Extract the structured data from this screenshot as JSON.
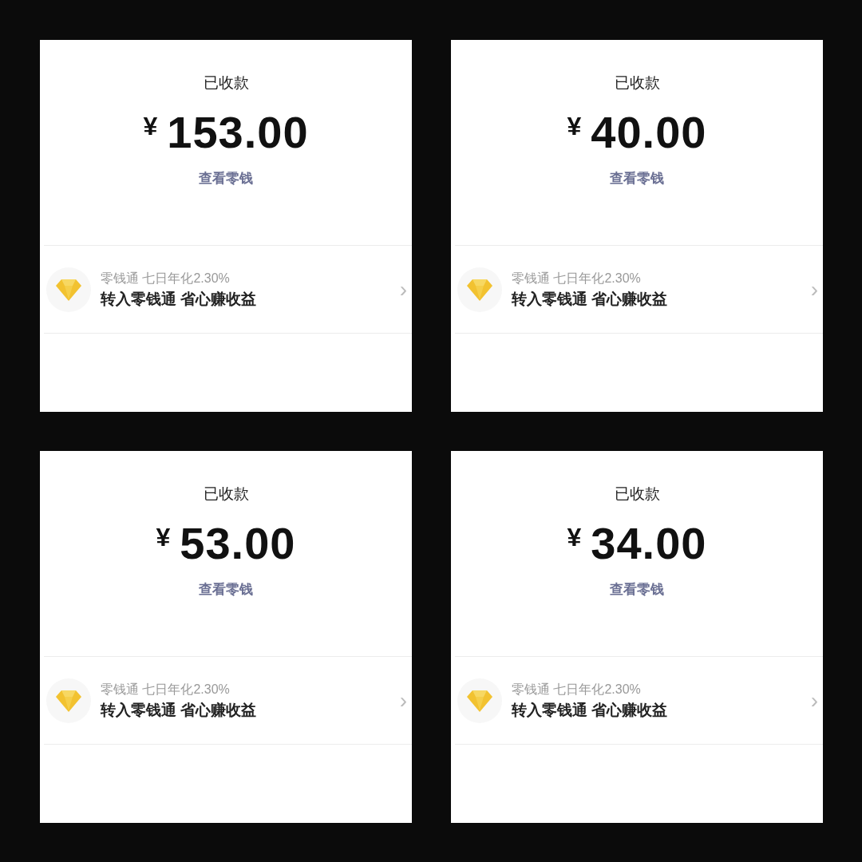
{
  "panels": [
    {
      "status": "已收款",
      "currency": "¥",
      "amount": "153.00",
      "link": "查看零钱",
      "promo": {
        "subtitle": "零钱通 七日年化2.30%",
        "title": "转入零钱通 省心赚收益",
        "chevron": "›"
      }
    },
    {
      "status": "已收款",
      "currency": "¥",
      "amount": "40.00",
      "link": "查看零钱",
      "promo": {
        "subtitle": "零钱通 七日年化2.30%",
        "title": "转入零钱通 省心赚收益",
        "chevron": "›"
      }
    },
    {
      "status": "已收款",
      "currency": "¥",
      "amount": "53.00",
      "link": "查看零钱",
      "promo": {
        "subtitle": "零钱通 七日年化2.30%",
        "title": "转入零钱通 省心赚收益",
        "chevron": "›"
      }
    },
    {
      "status": "已收款",
      "currency": "¥",
      "amount": "34.00",
      "link": "查看零钱",
      "promo": {
        "subtitle": "零钱通 七日年化2.30%",
        "title": "转入零钱通 省心赚收益",
        "chevron": "›"
      }
    }
  ]
}
